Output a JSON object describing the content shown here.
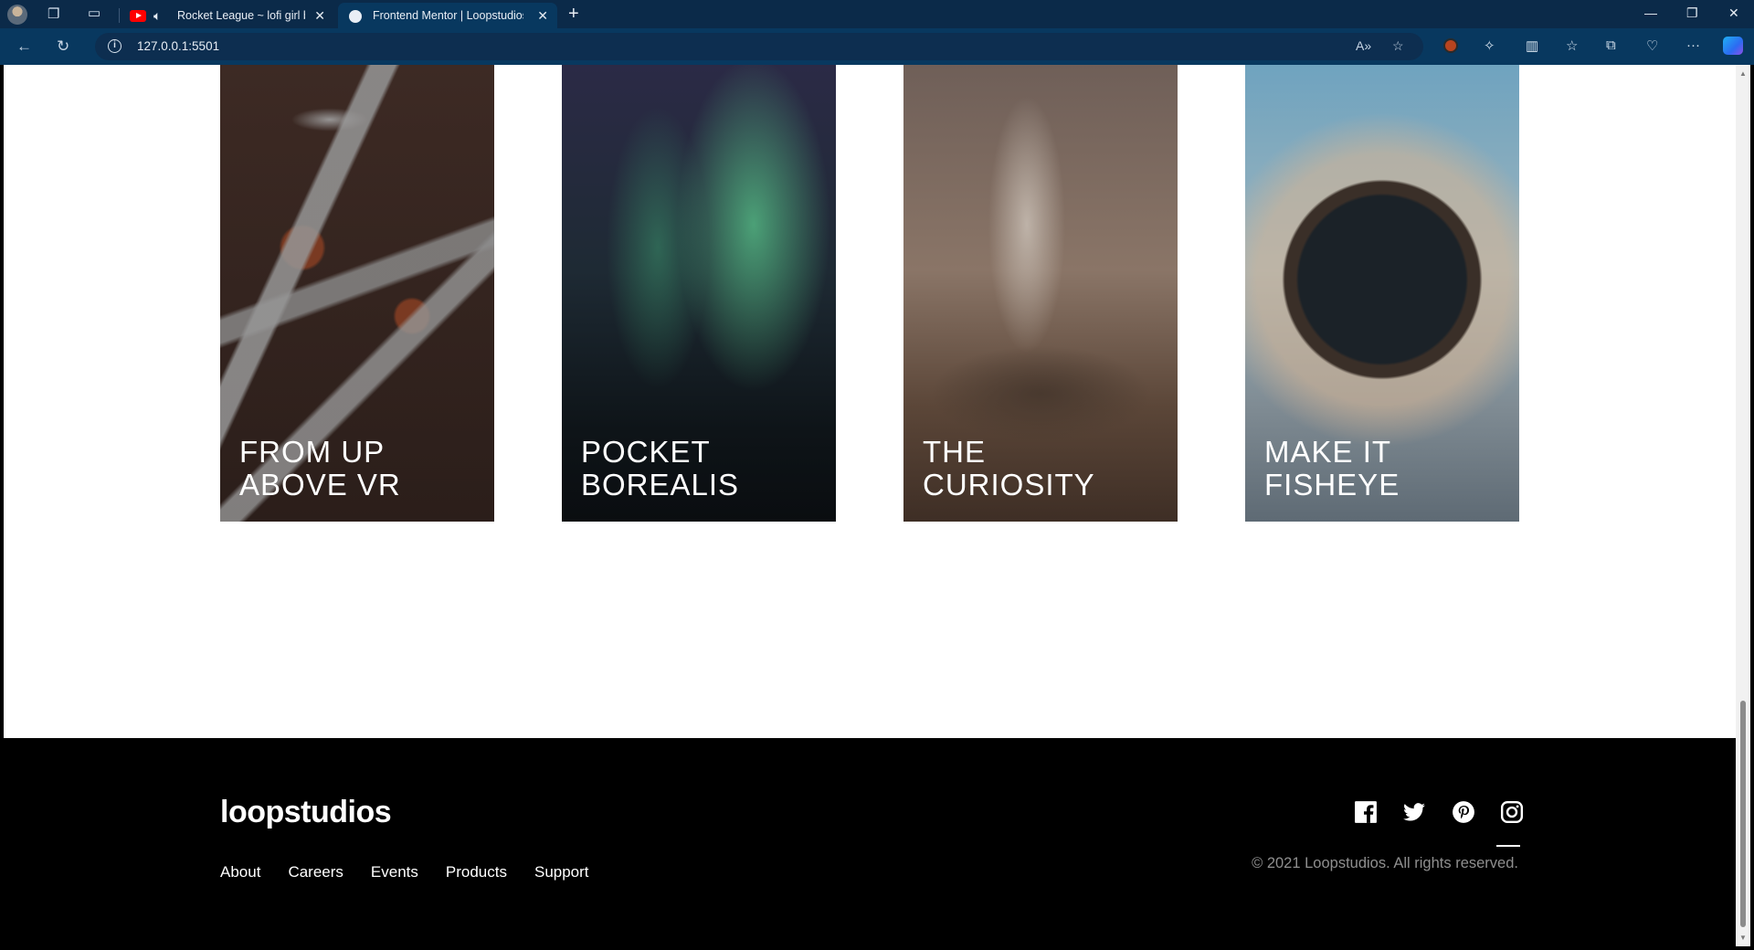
{
  "browser": {
    "tabs": [
      {
        "title": "Rocket League ~ lofi girl be",
        "active": false
      },
      {
        "title": "Frontend Mentor | Loopstudios l",
        "active": true
      }
    ],
    "url": "127.0.0.1:5501"
  },
  "creations": [
    {
      "line1": "FROM UP",
      "line2": "ABOVE VR"
    },
    {
      "line1": "POCKET",
      "line2": "BOREALIS"
    },
    {
      "line1": "THE",
      "line2": "CURIOSITY"
    },
    {
      "line1": "MAKE IT",
      "line2": "FISHEYE"
    }
  ],
  "footer": {
    "logo": "loopstudios",
    "nav": [
      "About",
      "Careers",
      "Events",
      "Products",
      "Support"
    ],
    "social": [
      "facebook-icon",
      "twitter-icon",
      "pinterest-icon",
      "instagram-icon"
    ],
    "copyright": "© 2021 Loopstudios. All rights reserved."
  }
}
